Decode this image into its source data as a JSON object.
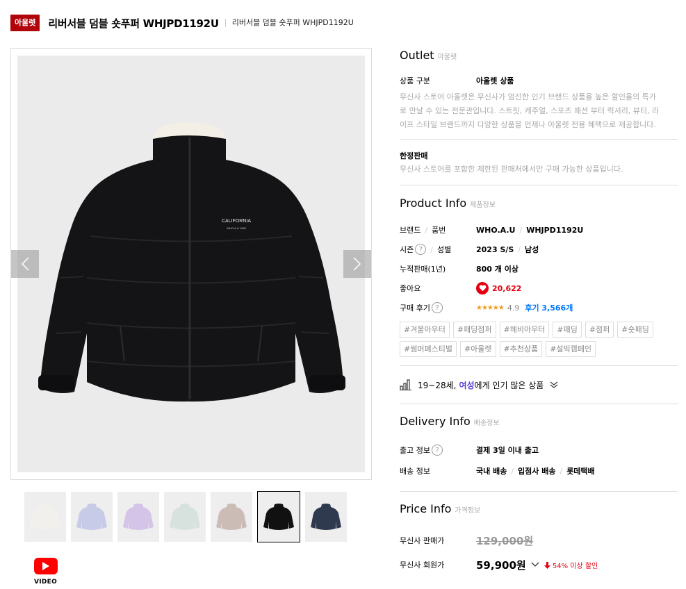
{
  "header": {
    "badge": "아울렛",
    "title": "리버서블 덤블 숏푸퍼 WHJPD1192U",
    "subtitle": "리버서블 덤블 숏푸퍼 WHJPD1192U"
  },
  "image": {
    "print_line1": "CALIFORNIA",
    "print_line2": "WHO.A.U 1945"
  },
  "thumbnails": [
    {
      "color": "#f1f0ec",
      "selected": false
    },
    {
      "color": "#c8cbe8",
      "selected": false
    },
    {
      "color": "#d3c4e8",
      "selected": false
    },
    {
      "color": "#d7e2df",
      "selected": false
    },
    {
      "color": "#cbbdb6",
      "selected": false
    },
    {
      "color": "#111111",
      "selected": true
    },
    {
      "color": "#2f3a4e",
      "selected": false
    }
  ],
  "video": {
    "label": "VIDEO"
  },
  "outlet": {
    "title": "Outlet",
    "subtitle": "아울렛",
    "type_label": "상품 구분",
    "type_value": "아울렛 상품",
    "desc_line1": "무신사 스토어 아울렛은 무신사가 엄선한 인기 브랜드 상품을 높은 할인율의 특가",
    "desc_line2": "로 만날 수 있는 전문관입니다. 스트릿, 캐주얼, 스포츠 패션 부터 럭셔리, 뷰티, 라",
    "desc_line3": "이프 스타일 브랜드까지 다양한 상품을 언제나 아울렛 전용 혜택으로 제공합니다."
  },
  "limited": {
    "title": "한정판매",
    "desc": "무신사 스토어를 포함한 제한된 판매처에서만 구매 가능한 상품입니다."
  },
  "product_info": {
    "title": "Product Info",
    "subtitle": "제품정보",
    "brand_label": "브랜드",
    "code_label": "품번",
    "brand": "WHO.A.U",
    "code": "WHJPD1192U",
    "season_label": "시즌",
    "gender_label": "성별",
    "season": "2023 S/S",
    "gender": "남성",
    "sales_label": "누적판매(1년)",
    "sales": "800 개 이상",
    "likes_label": "좋아요",
    "likes": "20,622",
    "review_label": "구매 후기",
    "stars": "★★★★★",
    "rating": "4.9",
    "reviews": "후기 3,566개",
    "qmark": "?"
  },
  "tags": [
    "#겨울아우터",
    "#패딩점퍼",
    "#헤비아우터",
    "#패딩",
    "#점퍼",
    "#숏패딩",
    "#썸머페스티벌",
    "#아울렛",
    "#추천상품",
    "#설빅캠페인"
  ],
  "popular": {
    "age": "19~28세,",
    "gender": "여성",
    "rest": "에게 인기 많은 상품"
  },
  "delivery": {
    "title": "Delivery Info",
    "subtitle": "배송정보",
    "ship_label": "출고 정보",
    "ship_value": "결제 3일 이내 출고",
    "method_label": "배송 정보",
    "method1": "국내 배송",
    "method2": "입점사 배송",
    "method3": "롯데택배"
  },
  "price": {
    "title": "Price Info",
    "subtitle": "가격정보",
    "sale_label": "무신사 판매가",
    "sale_price": "129,000원",
    "member_label": "무신사 회원가",
    "member_price": "59,900원",
    "discount": "54% 이상 할인"
  },
  "colors": {
    "brand_red": "#b0040a",
    "discount_red": "#e60012",
    "link_blue": "#0078ff",
    "accent_purple": "#5a3fd6",
    "star_orange": "#f39c1b"
  }
}
